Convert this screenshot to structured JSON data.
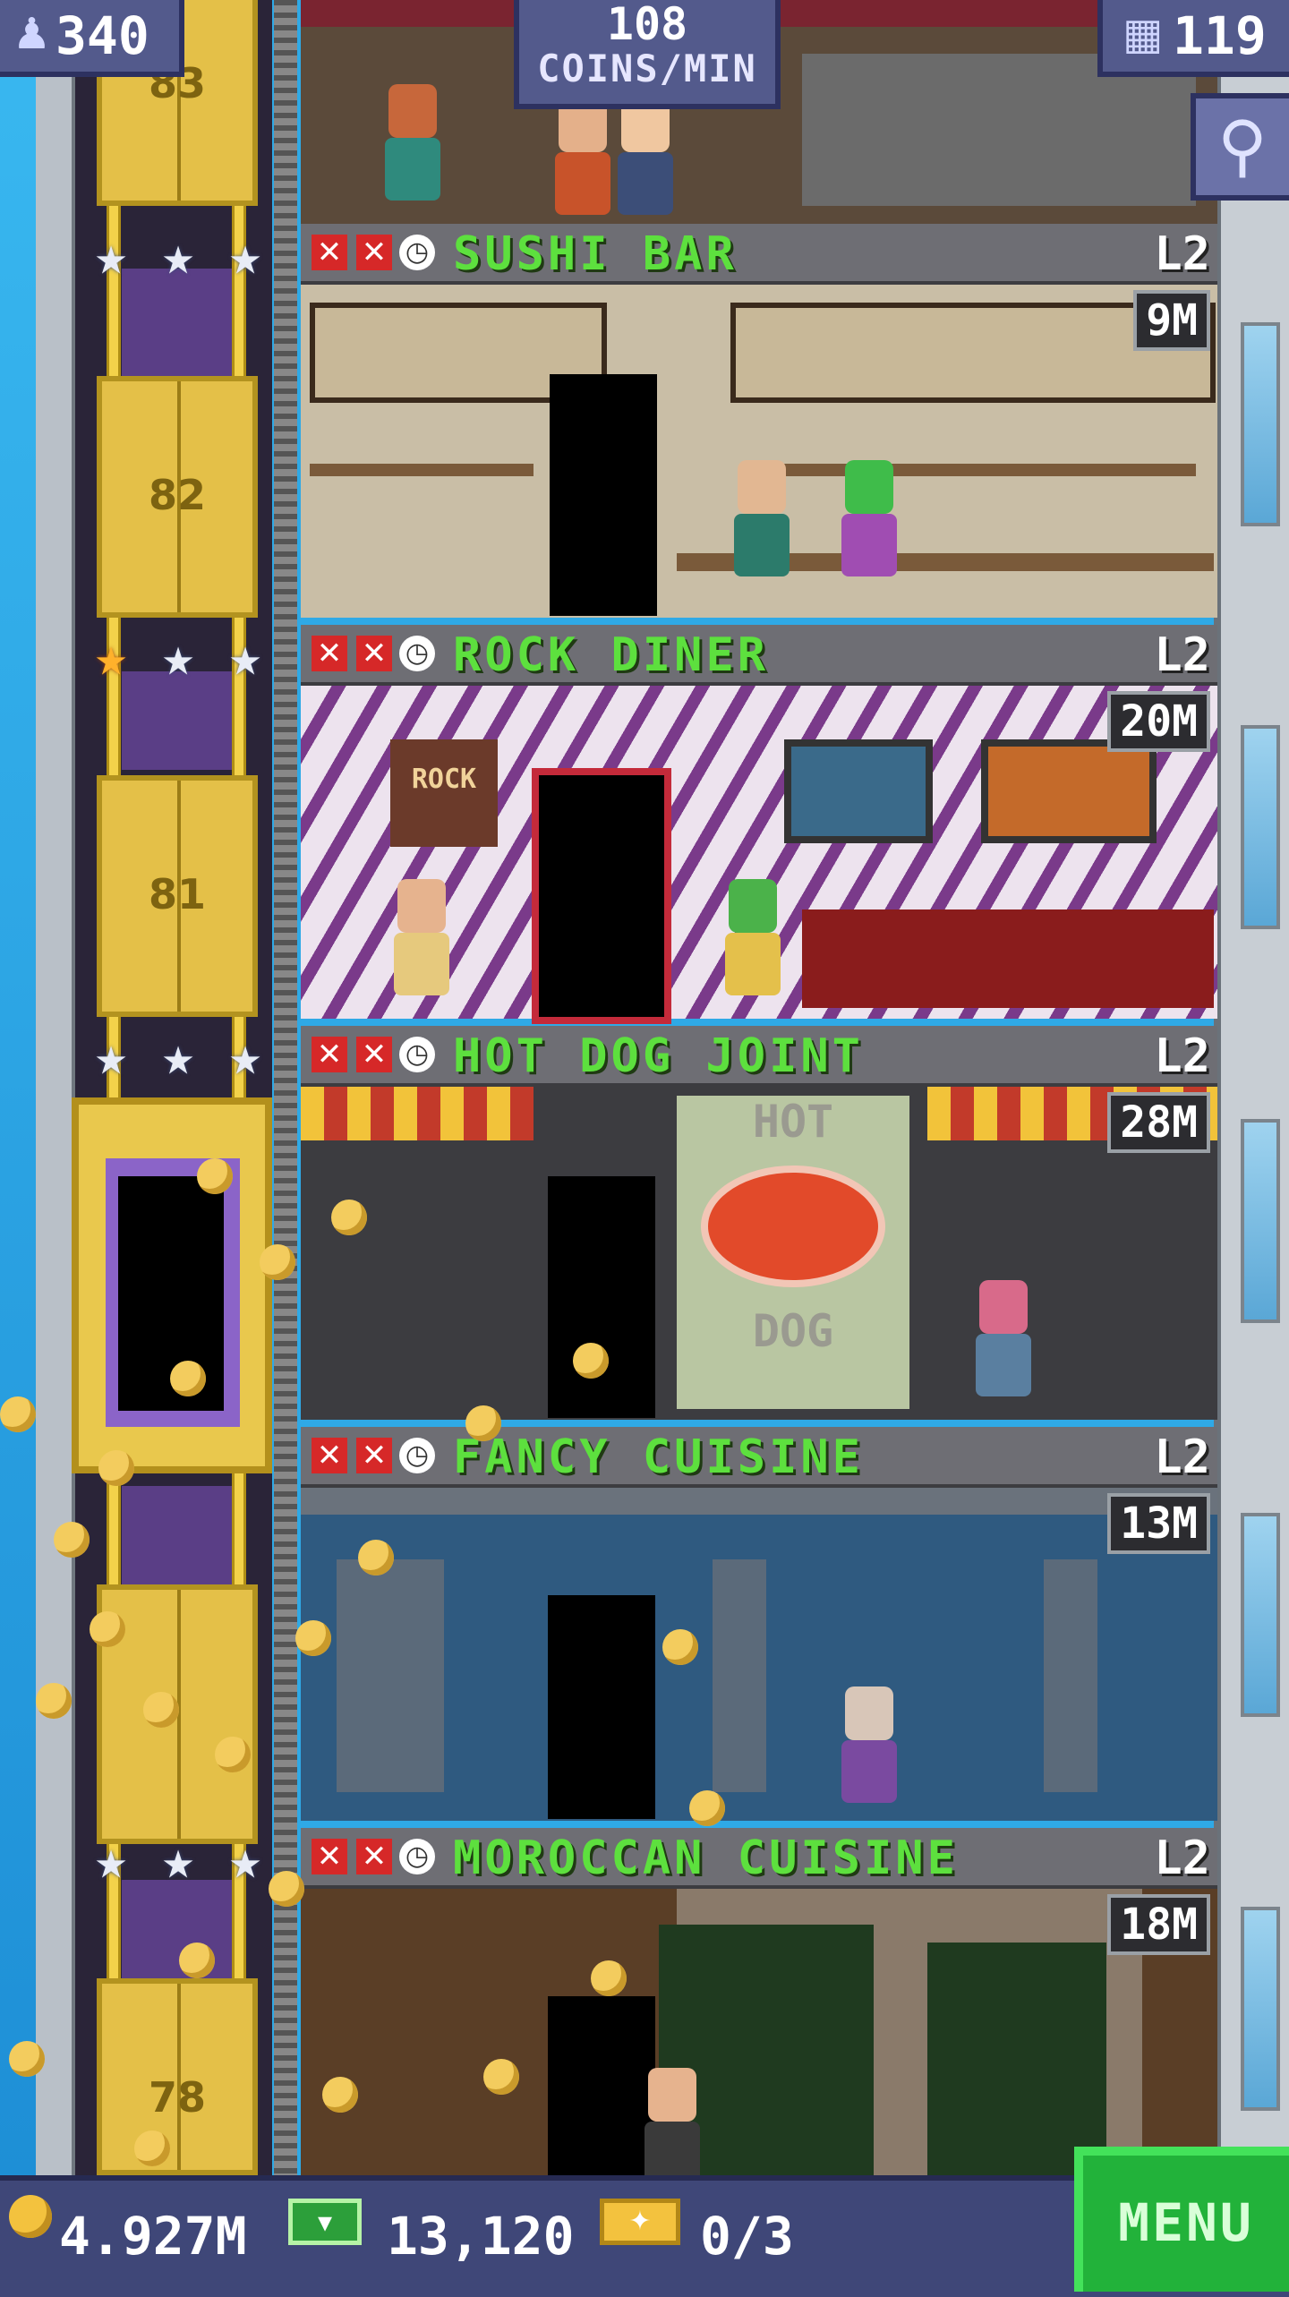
{
  "hud": {
    "population": "340",
    "population_icon": "person-icon",
    "coins_rate_value": "108",
    "coins_rate_unit": "COINS/MIN",
    "floor_count": "119",
    "floor_icon": "building-icon",
    "search_icon": "magnifier-icon"
  },
  "elevator": {
    "stop_labels": [
      "83",
      "82",
      "81",
      "78"
    ],
    "star_rows": [
      {
        "stars": [
          "silver",
          "silver",
          "silver"
        ]
      },
      {
        "stars": [
          "gold",
          "silver",
          "silver"
        ]
      },
      {
        "stars": [
          "silver",
          "silver",
          "silver"
        ]
      },
      {
        "stars": [
          "silver",
          "silver",
          "silver"
        ]
      }
    ]
  },
  "floors": [
    {
      "name": "SUSHI BAR",
      "level": "L2",
      "stock": "9M"
    },
    {
      "name": "ROCK DINER",
      "level": "L2",
      "stock": "20M"
    },
    {
      "name": "HOT DOG JOINT",
      "level": "L2",
      "stock": "28M"
    },
    {
      "name": "FANCY CUISINE",
      "level": "L2",
      "stock": "13M"
    },
    {
      "name": "MOROCCAN CUISINE",
      "level": "L2",
      "stock": "18M"
    }
  ],
  "signage": {
    "hotdog_top": "HOT",
    "hotdog_bottom": "DOG",
    "rock_sign": "ROCK"
  },
  "bottom_bar": {
    "coins": "4.927M",
    "bux": "13,120",
    "tickets": "0/3",
    "menu_label": "MENU"
  },
  "colors": {
    "floor_name": "#5de03e",
    "menu_button": "#22b23a",
    "hud_panel": "#535a8c",
    "coin": "#f3cc5e",
    "status_x": "#d62828"
  }
}
